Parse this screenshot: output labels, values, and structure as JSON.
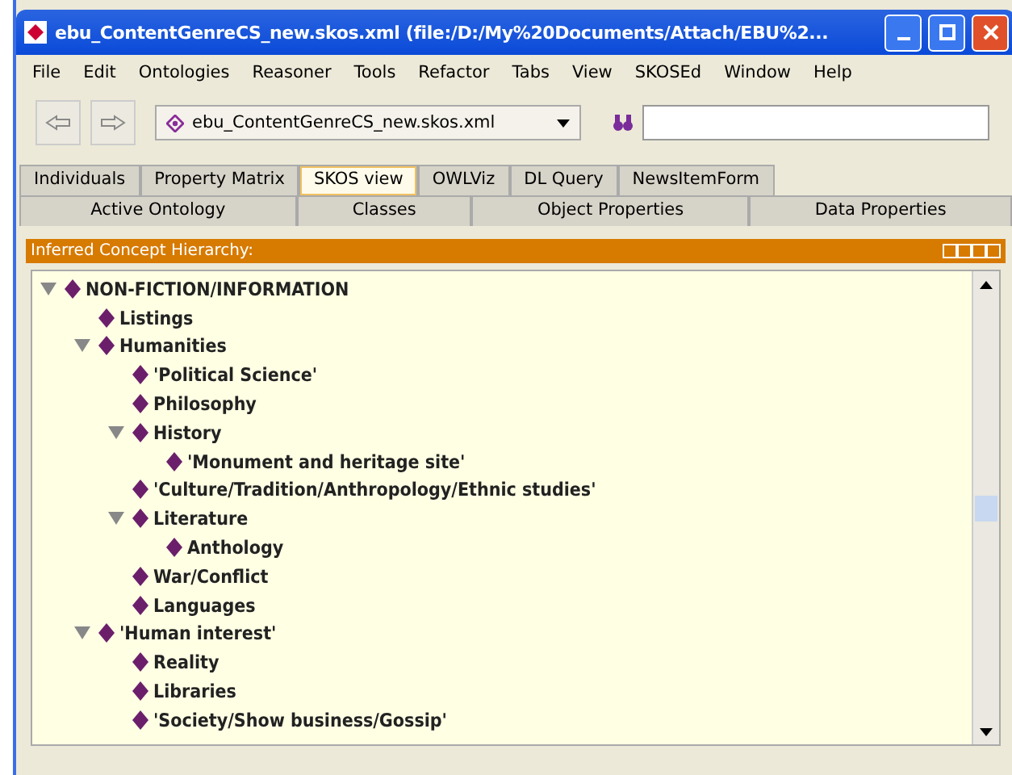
{
  "window": {
    "title": "ebu_ContentGenreCS_new.skos.xml (file:/D:/My%20Documents/Attach/EBU%2..."
  },
  "menu": [
    "File",
    "Edit",
    "Ontologies",
    "Reasoner",
    "Tools",
    "Refactor",
    "Tabs",
    "View",
    "SKOSEd",
    "Window",
    "Help"
  ],
  "toolbar": {
    "ontology": "ebu_ContentGenreCS_new.skos.xml"
  },
  "tabs_row_1": [
    {
      "label": "Individuals",
      "selected": false
    },
    {
      "label": "Property Matrix",
      "selected": false
    },
    {
      "label": "SKOS view",
      "selected": true
    },
    {
      "label": "OWLViz",
      "selected": false
    },
    {
      "label": "DL Query",
      "selected": false
    },
    {
      "label": "NewsItemForm",
      "selected": false
    }
  ],
  "tabs_row_2": [
    {
      "label": "Active Ontology",
      "selected": false
    },
    {
      "label": "Classes",
      "selected": false
    },
    {
      "label": "Object Properties",
      "selected": false
    },
    {
      "label": "Data Properties",
      "selected": false
    }
  ],
  "panel": {
    "title": "Inferred Concept Hierarchy:",
    "tree": [
      {
        "label": "NON-FICTION/INFORMATION",
        "expanded": true,
        "children": [
          {
            "label": "Listings"
          },
          {
            "label": "Humanities",
            "expanded": true,
            "children": [
              {
                "label": "'Political Science'"
              },
              {
                "label": "Philosophy"
              },
              {
                "label": "History",
                "expanded": true,
                "children": [
                  {
                    "label": "'Monument and heritage site'"
                  }
                ]
              },
              {
                "label": "'Culture/Tradition/Anthropology/Ethnic studies'"
              },
              {
                "label": "Literature",
                "expanded": true,
                "children": [
                  {
                    "label": "Anthology"
                  }
                ]
              },
              {
                "label": "War/Conflict"
              },
              {
                "label": "Languages"
              }
            ]
          },
          {
            "label": "'Human interest'",
            "expanded": true,
            "children": [
              {
                "label": "Reality"
              },
              {
                "label": "Libraries"
              },
              {
                "label": "'Society/Show business/Gossip'"
              }
            ]
          }
        ]
      }
    ]
  }
}
